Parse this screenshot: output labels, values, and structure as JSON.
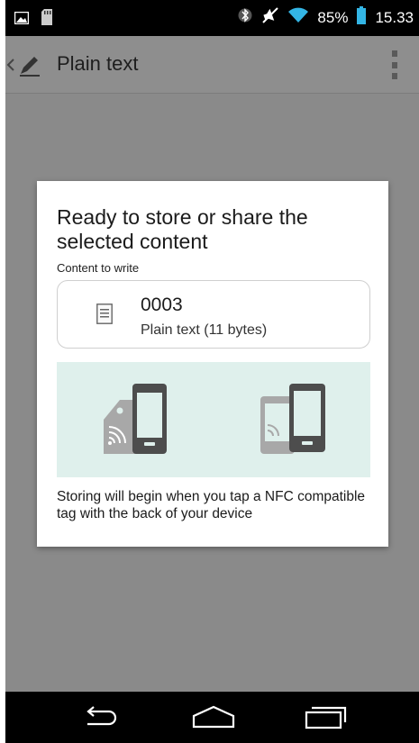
{
  "status_bar": {
    "battery_percent": "85%",
    "time": "15.33",
    "icons": [
      "image-icon",
      "sd-card-icon",
      "bluetooth-icon",
      "mute-icon",
      "wifi-icon",
      "battery-icon"
    ]
  },
  "action_bar": {
    "title": "Plain text",
    "icons": [
      "back-caret-icon",
      "pencil-icon",
      "overflow-menu-icon"
    ]
  },
  "dialog": {
    "title": "Ready to store or share the selected content",
    "content_label": "Content to write",
    "content_item": {
      "name": "0003",
      "description": "Plain text (11 bytes)",
      "icon": "document-icon"
    },
    "illustration": [
      "nfc-tag-icon",
      "phone-to-phone-icon"
    ],
    "hint": "Storing will begin when you tap a NFC compatible tag with the back of your device"
  },
  "nav_bar": {
    "icons": [
      "back-icon",
      "home-icon",
      "recent-apps-icon"
    ]
  },
  "colors": {
    "status_bar": "#000000",
    "dim_overlay": "#8a8a8a",
    "dialog_bg": "#ffffff",
    "illustration_bg": "#dff0ec",
    "device_dark": "#4d4d4d",
    "device_light": "#a8a8a8"
  }
}
